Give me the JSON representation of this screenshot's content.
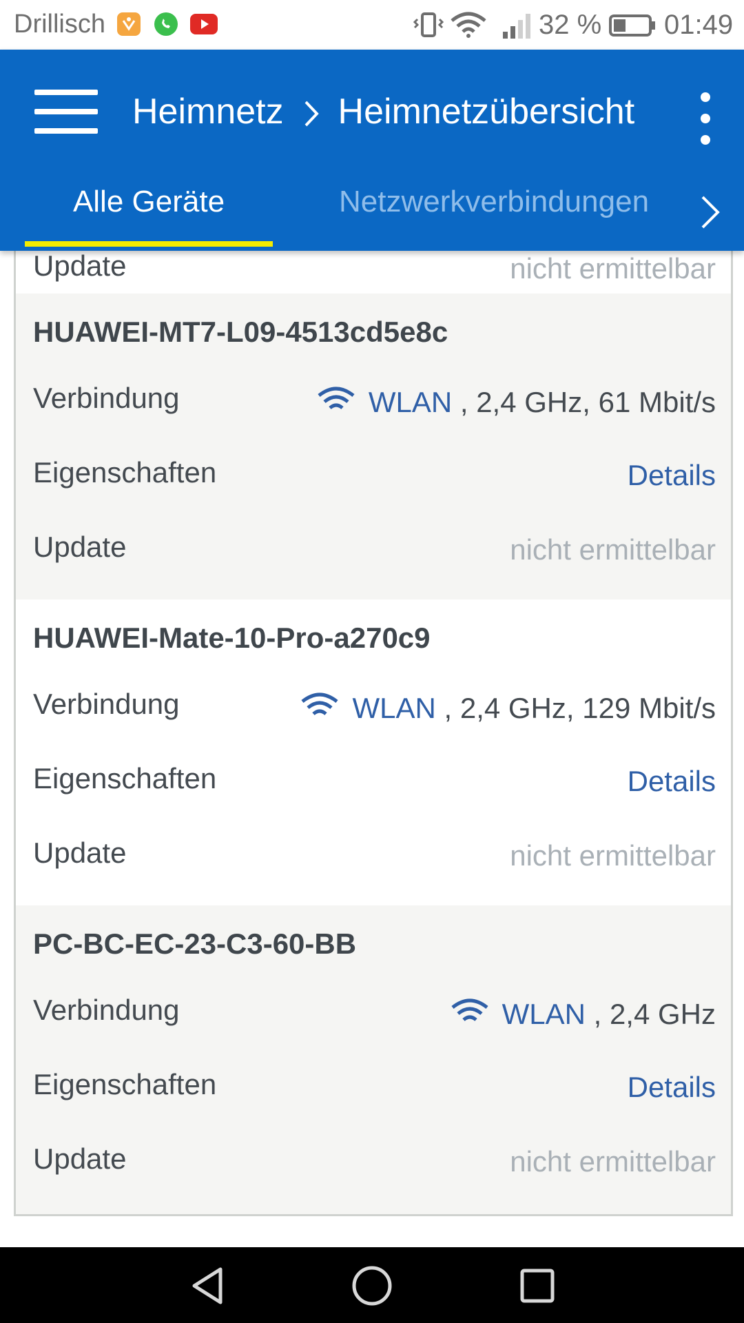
{
  "status_bar": {
    "carrier": "Drillisch",
    "battery_percent": "32 %",
    "time": "01:49",
    "notification_icons": [
      "app-notification-icon",
      "whatsapp-icon",
      "youtube-icon"
    ],
    "system_icons": [
      "vibrate-icon",
      "wifi-icon",
      "cell-signal-icon",
      "battery-icon"
    ]
  },
  "appbar": {
    "breadcrumb_parent": "Heimnetz",
    "breadcrumb_current": "Heimnetzübersicht",
    "background": "#0b68c4"
  },
  "tabs": [
    {
      "label": "Alle Geräte",
      "active": true
    },
    {
      "label": "Netzwerkverbindungen",
      "active": false
    }
  ],
  "partial_row": {
    "label": "Update",
    "value": "nicht ermittelbar"
  },
  "devices": [
    {
      "name": "HUAWEI-MT7-L09-4513cd5e8c",
      "connection_label": "Verbindung",
      "connection_type": "WLAN",
      "connection_detail": " , 2,4 GHz, 61 Mbit/s",
      "properties_label": "Eigenschaften",
      "properties_link": "Details",
      "update_label": "Update",
      "update_value": "nicht ermittelbar"
    },
    {
      "name": "HUAWEI-Mate-10-Pro-a270c9",
      "connection_label": "Verbindung",
      "connection_type": "WLAN",
      "connection_detail": " , 2,4 GHz, 129 Mbit/s",
      "properties_label": "Eigenschaften",
      "properties_link": "Details",
      "update_label": "Update",
      "update_value": "nicht ermittelbar"
    },
    {
      "name": "PC-BC-EC-23-C3-60-BB",
      "connection_label": "Verbindung",
      "connection_type": "WLAN",
      "connection_detail": " , 2,4 GHz",
      "properties_label": "Eigenschaften",
      "properties_link": "Details",
      "update_label": "Update",
      "update_value": "nicht ermittelbar"
    }
  ],
  "nav_bar": {
    "buttons": [
      "back-icon",
      "home-icon",
      "recents-icon"
    ]
  },
  "colors": {
    "link": "#2f5fa7",
    "tab_indicator": "#f4ec00",
    "muted": "#a9b0b6"
  }
}
